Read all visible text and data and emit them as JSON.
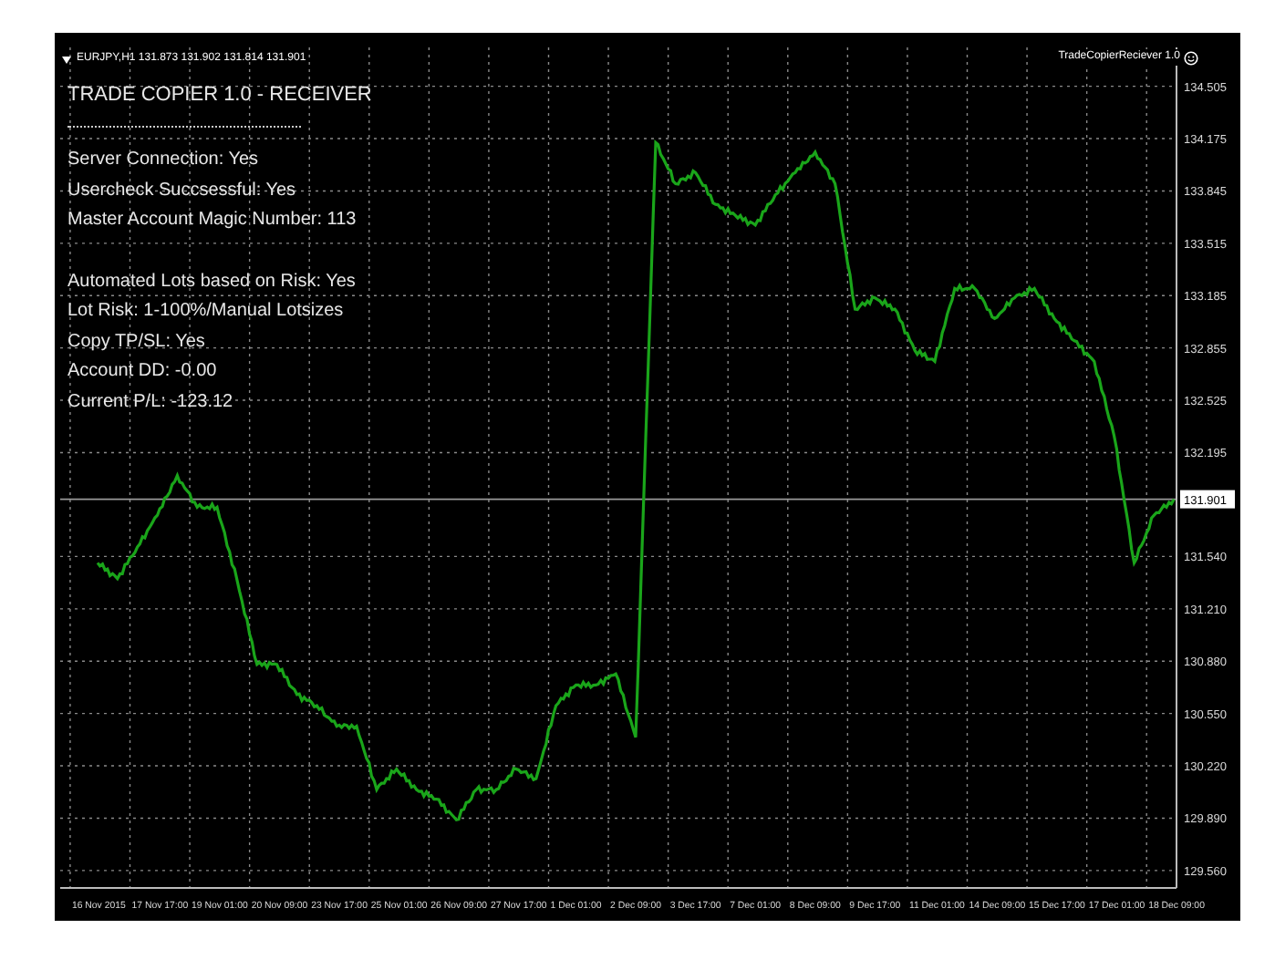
{
  "chart": {
    "symbol_line": "EURJPY,H1  131.873 131.902 131.814 131.901",
    "expert": "TradeCopierReciever 1.0",
    "chart_data": {
      "type": "line",
      "categories": [
        "16 Nov 2015",
        null,
        null,
        "17 Nov 17:00",
        null,
        null,
        "19 Nov 01:00",
        null,
        null,
        "20 Nov 09:00",
        null,
        null,
        "23 Nov 17:00",
        null,
        null,
        "25 Nov 01:00",
        null,
        null,
        "26 Nov 09:00",
        null,
        null,
        "27 Nov 17:00",
        null,
        null,
        "1 Dec 01:00",
        null,
        null,
        "2 Dec 09:00",
        null,
        null,
        "3 Dec 17:00",
        null,
        null,
        "7 Dec 01:00",
        null,
        null,
        "8 Dec 09:00",
        null,
        null,
        "9 Dec 17:00",
        null,
        null,
        "11 Dec 01:00",
        null,
        null,
        "14 Dec 09:00",
        null,
        null,
        "15 Dec 17:00",
        null,
        null,
        "17 Dec 01:00",
        null,
        null,
        "18 Dec 09:00",
        null
      ],
      "series": [
        {
          "color": "#1aa51a",
          "values": [
            131.5,
            131.4,
            131.6,
            131.8,
            132.05,
            131.85,
            131.85,
            131.39,
            130.86,
            130.86,
            130.67,
            130.6,
            130.47,
            130.47,
            130.07,
            130.2,
            130.07,
            130.01,
            129.88,
            130.07,
            130.07,
            130.2,
            130.14,
            130.6,
            130.73,
            130.73,
            130.8,
            130.4,
            134.15,
            133.89,
            133.96,
            133.76,
            133.69,
            133.63,
            133.82,
            133.96,
            134.09,
            133.89,
            133.1,
            133.17,
            133.1,
            132.84,
            132.77,
            133.23,
            133.23,
            133.04,
            133.17,
            133.23,
            133.04,
            132.9,
            132.77,
            132.3,
            131.5,
            131.8,
            131.9,
            null
          ]
        }
      ],
      "ylim": [
        129.45,
        134.75
      ],
      "grid": true,
      "ref_lines": [
        {
          "axis": "y",
          "value": 131.901,
          "label": "131.901"
        }
      ],
      "yticks": [
        {
          "value": 134.505,
          "label": "134.505"
        },
        {
          "value": 134.175,
          "label": "134.175"
        },
        {
          "value": 133.845,
          "label": "133.845"
        },
        {
          "value": 133.515,
          "label": "133.515"
        },
        {
          "value": 133.185,
          "label": "133.185"
        },
        {
          "value": 132.855,
          "label": "132.855"
        },
        {
          "value": 132.525,
          "label": "132.525"
        },
        {
          "value": 132.195,
          "label": "132.195"
        },
        {
          "value": 131.54,
          "label": "131.540"
        },
        {
          "value": 131.21,
          "label": "131.210"
        },
        {
          "value": 130.88,
          "label": "130.880"
        },
        {
          "value": 130.55,
          "label": "130.550"
        },
        {
          "value": 130.22,
          "label": "130.220"
        },
        {
          "value": 129.89,
          "label": "129.890"
        },
        {
          "value": 129.56,
          "label": "129.560"
        }
      ]
    }
  },
  "panel": {
    "title": "TRADE COPIER 1.0 - RECEIVER",
    "groups": [
      [
        "Server Connection: Yes",
        "Usercheck Succsessful: Yes",
        "Master Account Magic Number: 113"
      ],
      [
        "Automated Lots based on Risk: Yes",
        "Lot Risk: 1-100%/Manual Lotsizes",
        "Copy TP/SL: Yes",
        "Account DD: -0.00",
        "Current P/L: -123.12"
      ]
    ]
  }
}
